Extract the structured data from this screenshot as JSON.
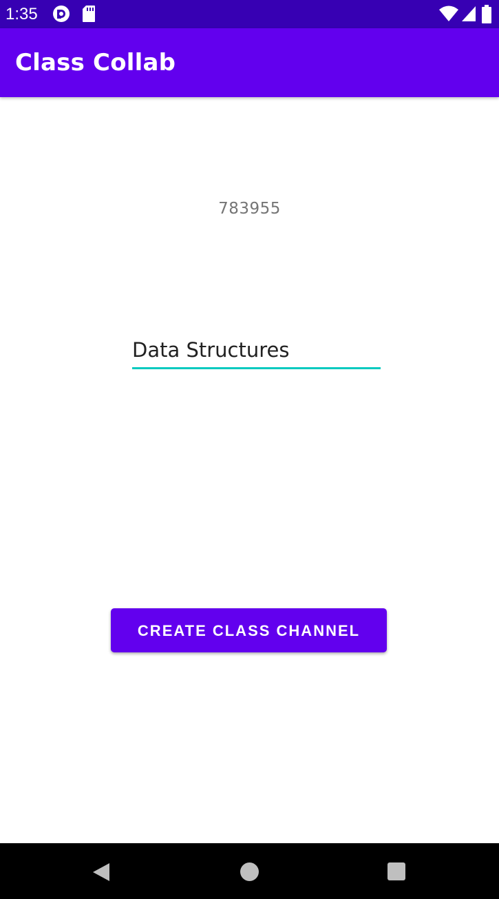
{
  "status_bar": {
    "time": "1:35",
    "icons": [
      "pocket-casts-icon",
      "sd-card-icon",
      "wifi-icon",
      "signal-icon",
      "battery-icon"
    ]
  },
  "app_bar": {
    "title": "Class Collab"
  },
  "main": {
    "class_code": "783955",
    "class_name_value": "Data Structures",
    "create_button_label": "CREATE CLASS CHANNEL"
  },
  "nav_bar": {
    "icons": [
      "back-icon",
      "home-icon",
      "recents-icon"
    ]
  },
  "colors": {
    "status_bar": "#3700b3",
    "primary": "#6200ee",
    "accent": "#03c9bf",
    "secondary_text": "#757575"
  }
}
